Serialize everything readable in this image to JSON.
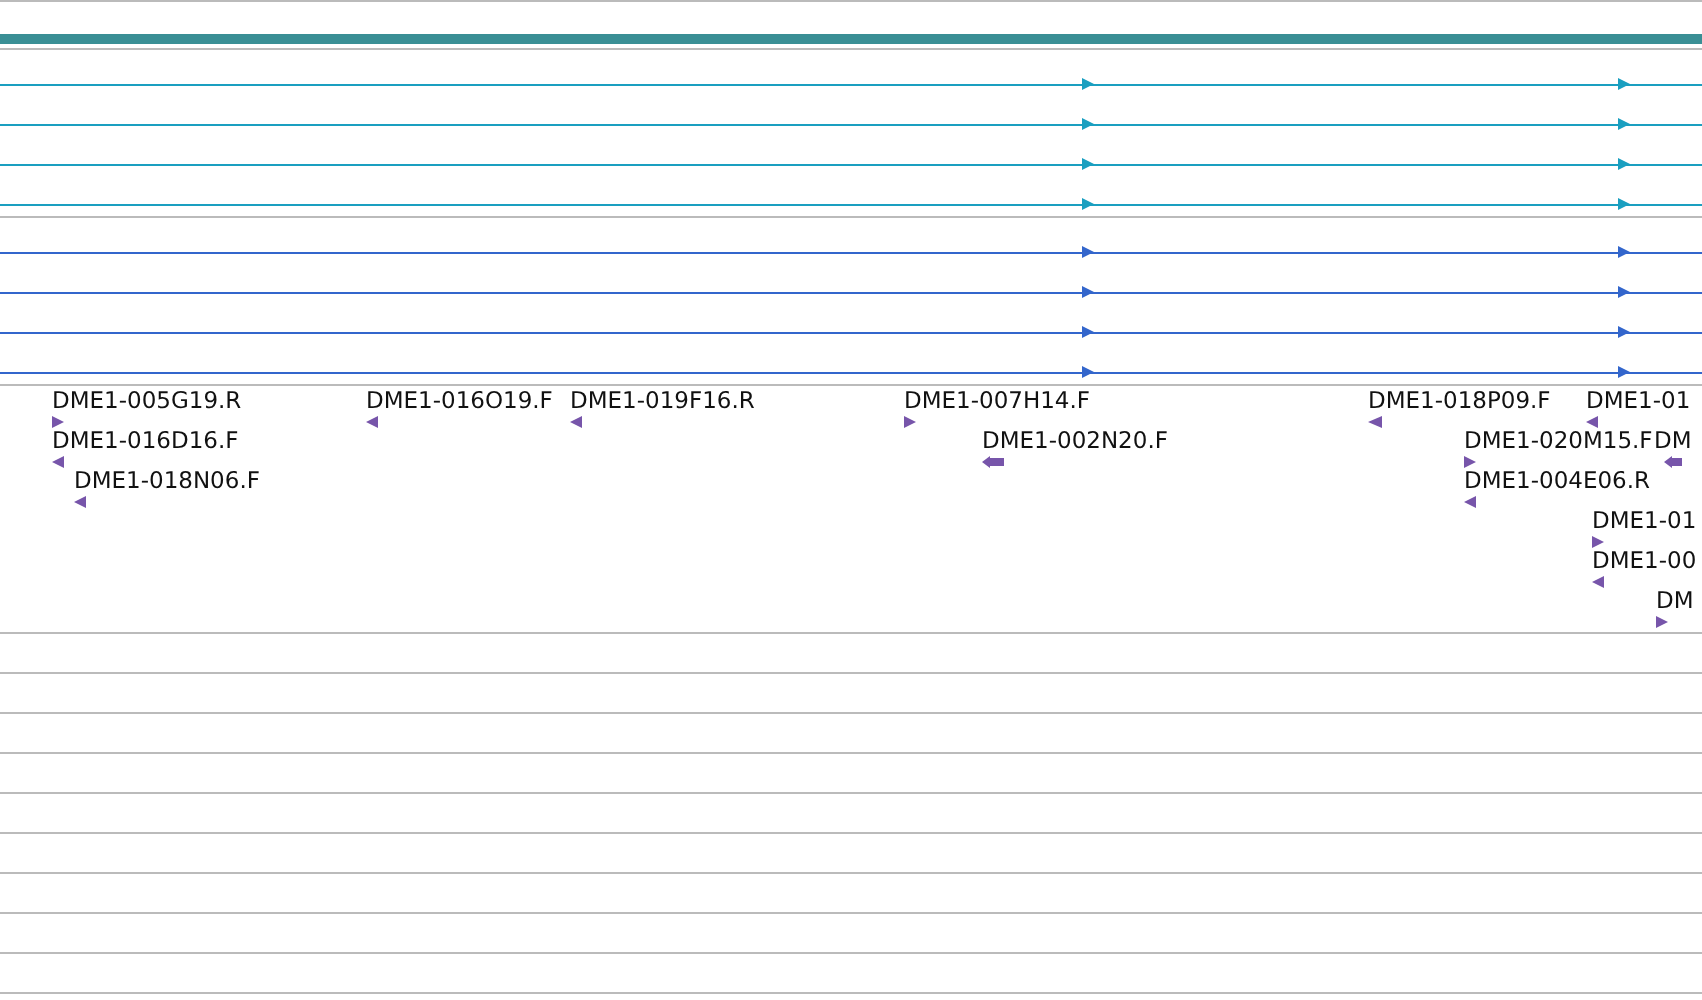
{
  "tracks": [
    {
      "color": "#1a9fc0",
      "rows": [
        {
          "reverse": false
        },
        {
          "reverse": false
        },
        {
          "reverse": false
        },
        {
          "reverse": false
        }
      ]
    },
    {
      "color": "#3366cc",
      "rows": [
        {
          "reverse": false
        },
        {
          "reverse": false
        },
        {
          "reverse": false
        },
        {
          "reverse": false
        }
      ]
    }
  ],
  "features": [
    {
      "label": "DME1-005G19.R",
      "reverse": false
    },
    {
      "label": "DME1-016D16.F",
      "reverse": true
    },
    {
      "label": "DME1-018N06.F",
      "reverse": true
    },
    {
      "label": "DME1-016O19.F",
      "reverse": true
    },
    {
      "label": "DME1-019F16.R",
      "reverse": true
    },
    {
      "label": "DME1-007H14.F",
      "reverse": false
    },
    {
      "label": "DME1-002N20.F",
      "reverse": true
    },
    {
      "label": "DME1-018P09.F",
      "reverse": true
    },
    {
      "label": "DME1-01",
      "reverse": true
    },
    {
      "label": "DME1-020M15.F",
      "reverse": false
    },
    {
      "label": "DM",
      "reverse": true
    },
    {
      "label": "DME1-004E06.R",
      "reverse": true
    },
    {
      "label": "DME1-01",
      "reverse": false
    },
    {
      "label": "DME1-00",
      "reverse": true
    },
    {
      "label": "DM",
      "reverse": false
    }
  ]
}
